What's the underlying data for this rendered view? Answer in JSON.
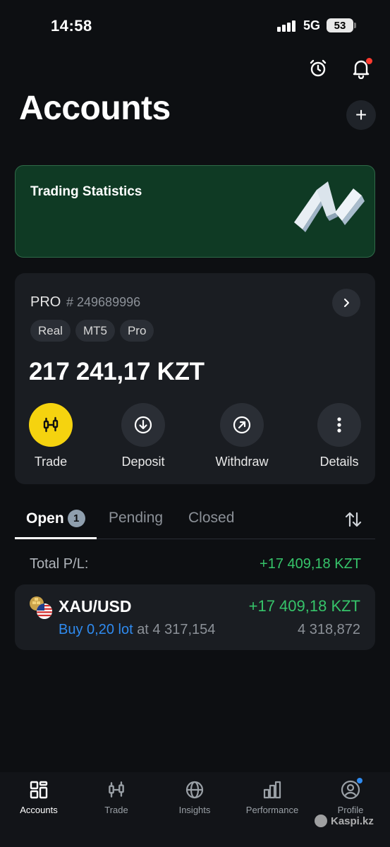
{
  "status_bar": {
    "time": "14:58",
    "network": "5G",
    "battery": "53"
  },
  "header": {
    "title": "Accounts",
    "icons": [
      "alarm-clock-icon",
      "bell-icon",
      "plus-icon"
    ]
  },
  "banner": {
    "title": "Trading Statistics",
    "art_icon": "3d-chart-icon"
  },
  "account": {
    "type": "PRO",
    "number": "# 249689996",
    "tags": [
      "Real",
      "MT5",
      "Pro"
    ],
    "balance": "217 241,17 KZT",
    "actions": [
      {
        "label": "Trade",
        "icon": "candlestick-icon"
      },
      {
        "label": "Deposit",
        "icon": "arrow-down-circle-icon"
      },
      {
        "label": "Withdraw",
        "icon": "arrow-up-right-circle-icon"
      },
      {
        "label": "Details",
        "icon": "more-vertical-icon"
      }
    ]
  },
  "tabs": {
    "open_label": "Open",
    "open_count": "1",
    "pending_label": "Pending",
    "closed_label": "Closed"
  },
  "totals": {
    "label": "Total P/L:",
    "value": "+17 409,18 KZT"
  },
  "position": {
    "symbol": "XAU/USD",
    "pl": "+17 409,18 KZT",
    "side_lot": "Buy 0,20 lot",
    "at_text": "at 4 317,154",
    "current": "4 318,872"
  },
  "nav": [
    {
      "label": "Accounts",
      "icon": "accounts-grid-icon"
    },
    {
      "label": "Trade",
      "icon": "candlestick-icon"
    },
    {
      "label": "Insights",
      "icon": "globe-icon"
    },
    {
      "label": "Performance",
      "icon": "bar-chart-icon"
    },
    {
      "label": "Profile",
      "icon": "user-circle-icon"
    }
  ],
  "watermark": "Kaspi.kz",
  "colors": {
    "background": "#0d0f12",
    "card": "#1a1d22",
    "accent_yellow": "#f5d30f",
    "profit_green": "#36c46a",
    "buy_blue": "#2f8bf0",
    "banner_green": "#0f3a24"
  }
}
